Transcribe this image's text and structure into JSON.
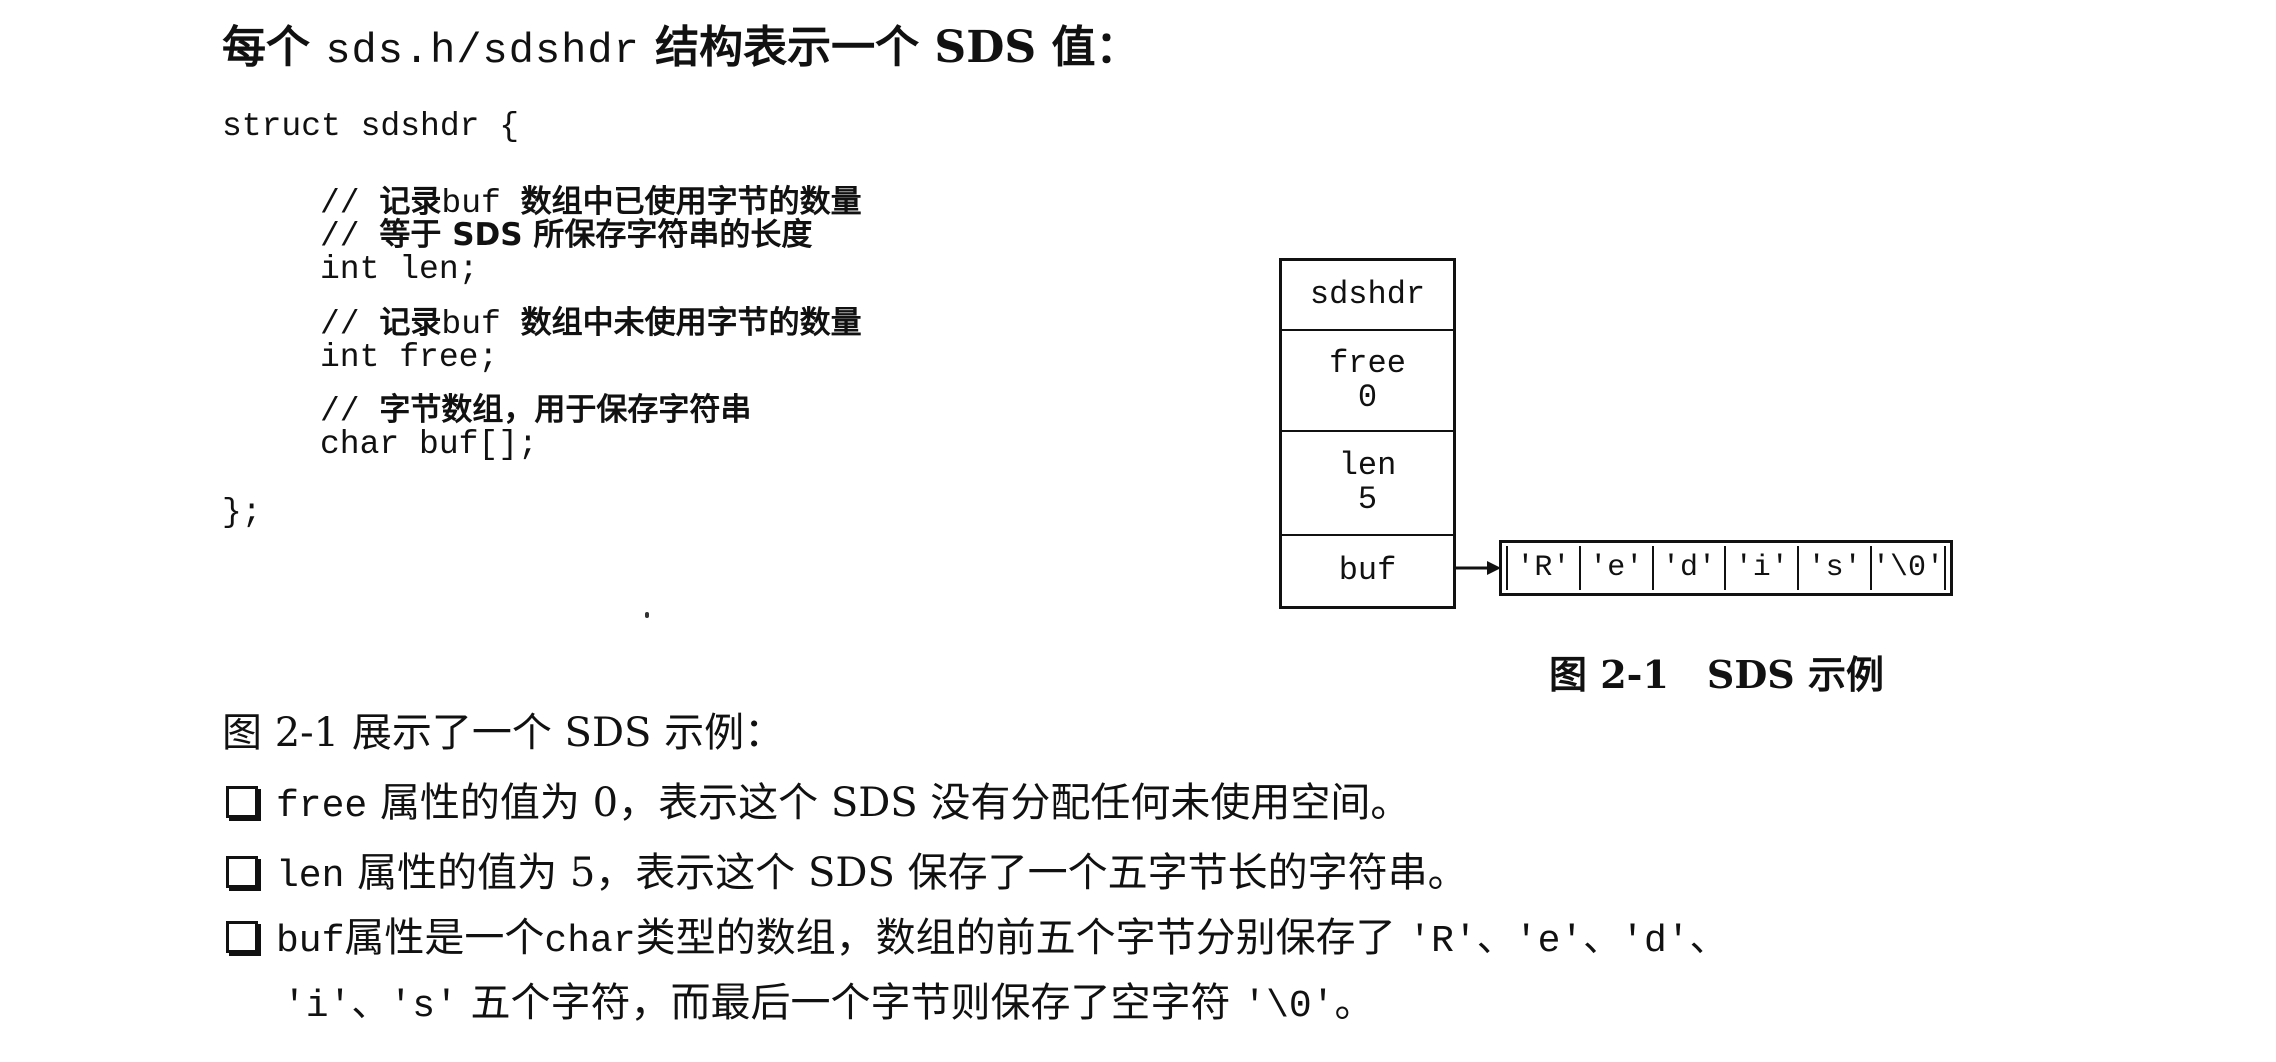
{
  "heading": {
    "prefix": "每个",
    "code": "sds.h/sdshdr",
    "suffix": "结构表示一个 SDS 值："
  },
  "code": {
    "struct_open": "struct sdshdr {",
    "comment_len_1_prefix": "//",
    "comment_len_1_a": "记录",
    "comment_len_1_code": "buf",
    "comment_len_1_b": "数组中已使用字节的数量",
    "comment_len_2_prefix": "//",
    "comment_len_2": "等于 SDS 所保存字符串的长度",
    "field_len": "int len;",
    "comment_free_prefix": "//",
    "comment_free_a": "记录",
    "comment_free_code": "buf",
    "comment_free_b": "数组中未使用字节的数量",
    "field_free": "int free;",
    "comment_buf_prefix": "//",
    "comment_buf": "字节数组，用于保存字符串",
    "field_buf": "char buf[];",
    "struct_close": "};"
  },
  "figure": {
    "struct_name": "sdshdr",
    "fields": [
      {
        "name": "free",
        "value": "0"
      },
      {
        "name": "len",
        "value": "5"
      },
      {
        "name": "buf",
        "value": ""
      }
    ],
    "buf_cells": [
      "'R'",
      "'e'",
      "'d'",
      "'i'",
      "'s'",
      "'\\0'"
    ],
    "caption_number": "图 2-1",
    "caption_text": "SDS 示例"
  },
  "body": {
    "intro": "图 2-1 展示了一个 SDS 示例：",
    "bullets": [
      {
        "code": "free",
        "text": "属性的值为 0，表示这个 SDS 没有分配任何未使用空间。"
      },
      {
        "code": "len",
        "text": "属性的值为 5，表示这个 SDS 保存了一个五字节长的字符串。"
      },
      {
        "code": "buf",
        "text_a": "属性是一个",
        "code_b": "char",
        "text_b": "类型的数组，数组的前五个字节分别保存了",
        "chars_line1": "'R'、'e'、'd'、",
        "chars_line2": "'i'、's'",
        "text_c": "五个字符，而最后一个字节则保存了空字符",
        "null_char": "'\\0'",
        "end": "。"
      }
    ]
  }
}
